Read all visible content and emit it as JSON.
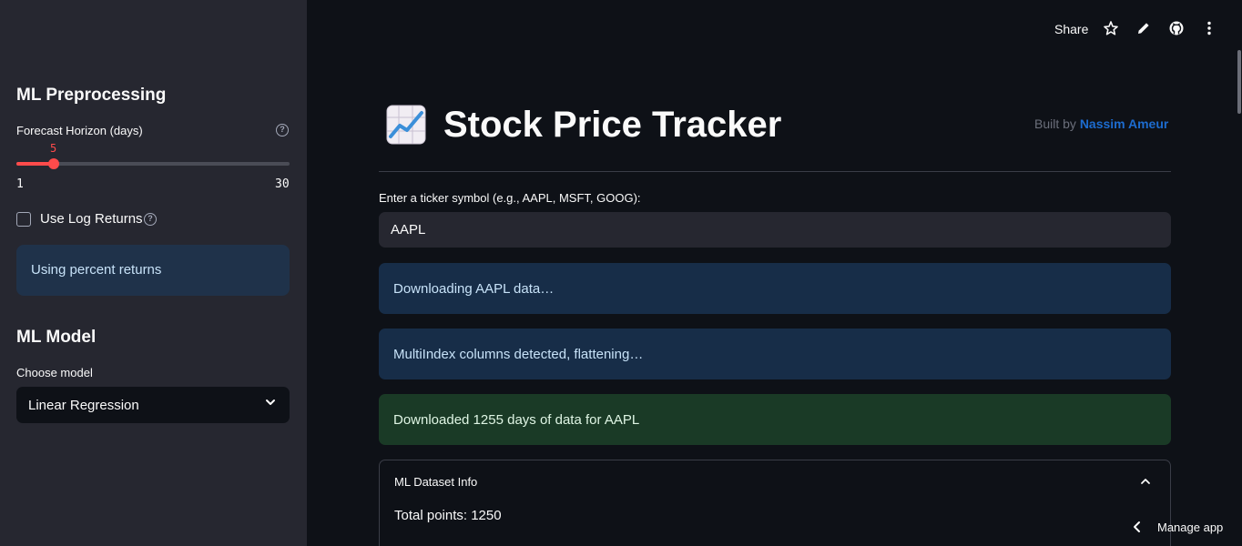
{
  "sidebar": {
    "preprocessing_title": "ML Preprocessing",
    "forecast_label": "Forecast Horizon (days)",
    "slider": {
      "value": "5",
      "min": "1",
      "max": "30",
      "fraction": 0.138
    },
    "log_returns_label": "Use Log Returns",
    "log_returns_checked": false,
    "info_text": "Using percent returns",
    "model_title": "ML Model",
    "model_label": "Choose model",
    "model_value": "Linear Regression"
  },
  "toolbar": {
    "share_label": "Share",
    "icons": [
      "star-icon",
      "edit-icon",
      "github-icon",
      "more-vertical-icon"
    ]
  },
  "main": {
    "title": "Stock Price Tracker",
    "built_by_prefix": "Built by",
    "built_by_name": "Nassim Ameur",
    "ticker_label": "Enter a ticker symbol (e.g., AAPL, MSFT, GOOG):",
    "ticker_value": "AAPL",
    "alerts": [
      {
        "text": "Downloading AAPL data…",
        "kind": "info"
      },
      {
        "text": "MultiIndex columns detected, flattening…",
        "kind": "info"
      },
      {
        "text": "Downloaded 1255 days of data for AAPL",
        "kind": "success"
      }
    ],
    "expander": {
      "title": "ML Dataset Info",
      "body": "Total points: 1250"
    }
  },
  "footer": {
    "manage_label": "Manage app"
  },
  "colors": {
    "accent": "#ff4b4b",
    "link": "#1d6ccf",
    "background": "#0e1117",
    "sidebar": "#262730"
  }
}
